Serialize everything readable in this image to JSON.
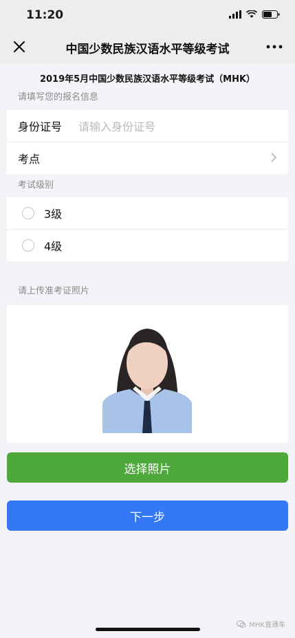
{
  "status_bar": {
    "time": "11:20"
  },
  "nav": {
    "title": "中国少数民族汉语水平等级考试"
  },
  "exam_title": "2019年5月中国少数民族汉语水平等级考试（MHK）",
  "info_section": {
    "label": "请填写您的报名信息",
    "id_label": "身份证号",
    "id_placeholder": "请输入身份证号",
    "venue_label": "考点"
  },
  "level_section": {
    "label": "考试级别",
    "options": [
      {
        "label": "3级"
      },
      {
        "label": "4级"
      }
    ]
  },
  "photo_section": {
    "label": "请上传准考证照片"
  },
  "buttons": {
    "choose_photo": "选择照片",
    "next": "下一步"
  },
  "watermark": "MHK直通车",
  "colors": {
    "green": "#4fa83b",
    "blue": "#3478f6"
  }
}
